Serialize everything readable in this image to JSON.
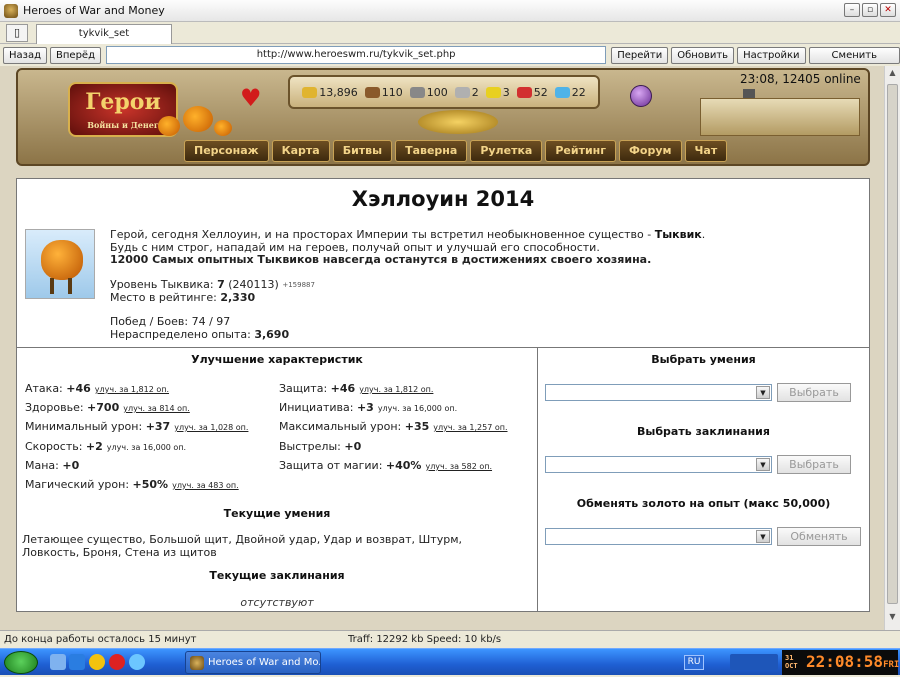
{
  "window": {
    "title": "Heroes of War and Money"
  },
  "tabs": [
    {
      "label": "tykvik_set"
    }
  ],
  "nav": {
    "back": "Назад",
    "forward": "Вперёд",
    "url": "http://www.heroeswm.ru/tykvik_set.php",
    "go": "Перейти",
    "refresh": "Обновить",
    "settings": "Настройки",
    "switch_player": "Сменить игрока"
  },
  "game_header": {
    "logo_text": "Герои",
    "logo_subtext": "Войны и Денег",
    "clock": "23:08, 12405 online",
    "resources": [
      {
        "icon": "gold-icon",
        "value": "13,896",
        "color": "#e0b430"
      },
      {
        "icon": "wood-icon",
        "value": "110",
        "color": "#8a5a2b"
      },
      {
        "icon": "ore-icon",
        "value": "100",
        "color": "#888888"
      },
      {
        "icon": "mercury-icon",
        "value": "2",
        "color": "#b0b0b0"
      },
      {
        "icon": "sulfur-icon",
        "value": "3",
        "color": "#e8d020"
      },
      {
        "icon": "crystals-icon",
        "value": "52",
        "color": "#d23030"
      },
      {
        "icon": "gems-icon",
        "value": "22",
        "color": "#4fb3e8"
      }
    ],
    "menu": [
      "Персонаж",
      "Карта",
      "Битвы",
      "Таверна",
      "Рулетка",
      "Рейтинг",
      "Форум",
      "Чат"
    ]
  },
  "event": {
    "title": "Хэллоуин 2014",
    "intro_line1": "Герой, сегодня Хеллоуин, и на просторах Империи ты встретил необыкновенное существо - ",
    "intro_name": "Тыквик",
    "intro_line1_end": ".",
    "intro_line2": "Будь с ним строг, нападай им на героев, получай опыт и улучшай его способности.",
    "intro_line3": "12000 Самых опытных Тыквиков навсегда останутся в достижениях своего хозяина.",
    "level_label": "Уровень Тыквика: ",
    "level_value": "7",
    "level_exp": "(240113)",
    "level_plus": "+159887",
    "rank_label": "Место в рейтинге: ",
    "rank_value": "2,330",
    "wins_label": "Побед / Боев: 74 / 97",
    "unspent_label": "Нераспределено опыта: ",
    "unspent_value": "3,690"
  },
  "improve": {
    "title": "Улучшение характеристик",
    "left": [
      {
        "label": "Атака: ",
        "value": "+46",
        "upgrade": "улуч. за 1,812 оп."
      },
      {
        "label": "Здоровье: ",
        "value": "+700",
        "upgrade": "улуч. за 814 оп."
      },
      {
        "label": "Минимальный урон: ",
        "value": "+37",
        "upgrade": "улуч. за 1,028 оп."
      },
      {
        "label": "Скорость: ",
        "value": "+2",
        "upgrade": "улуч. за 16,000 оп."
      },
      {
        "label": "Мана: ",
        "value": "+0",
        "upgrade": ""
      },
      {
        "label": "Магический урон: ",
        "value": "+50%",
        "upgrade": "улуч. за 483 оп."
      }
    ],
    "right": [
      {
        "label": "Защита: ",
        "value": "+46",
        "upgrade": "улуч. за 1,812 оп."
      },
      {
        "label": "Инициатива: ",
        "value": "+3",
        "upgrade": "улуч. за 16,000 оп."
      },
      {
        "label": "Максимальный урон: ",
        "value": "+35",
        "upgrade": "улуч. за 1,257 оп."
      },
      {
        "label": "Выстрелы: ",
        "value": "+0",
        "upgrade": ""
      },
      {
        "label": "Защита от магии: ",
        "value": "+40%",
        "upgrade": "улуч. за 582 оп."
      }
    ]
  },
  "skills": {
    "title": "Текущие умения",
    "text": "Летающее существо, Большой щит, Двойной удар, Удар и возврат, Штурм, Ловкость, Броня, Стена из щитов"
  },
  "spells": {
    "title": "Текущие заклинания",
    "text": "отсутствуют"
  },
  "right_panel": {
    "choose_skills": "Выбрать умения",
    "choose_spells": "Выбрать заклинания",
    "exchange": "Обменять золото на опыт (макс 50,000)",
    "choose_btn": "Выбрать",
    "exchange_btn": "Обменять"
  },
  "statusbar": {
    "left": "До конца работы осталось 15 минут",
    "mid": "Traff: 12292 kb Speed: 10 kb/s"
  },
  "taskbar": {
    "item": "Heroes of War and Mo...",
    "lang": "RU",
    "clock": "22:08:58",
    "date_day": "31",
    "date_month": "OCT",
    "weekday": "FRI"
  }
}
